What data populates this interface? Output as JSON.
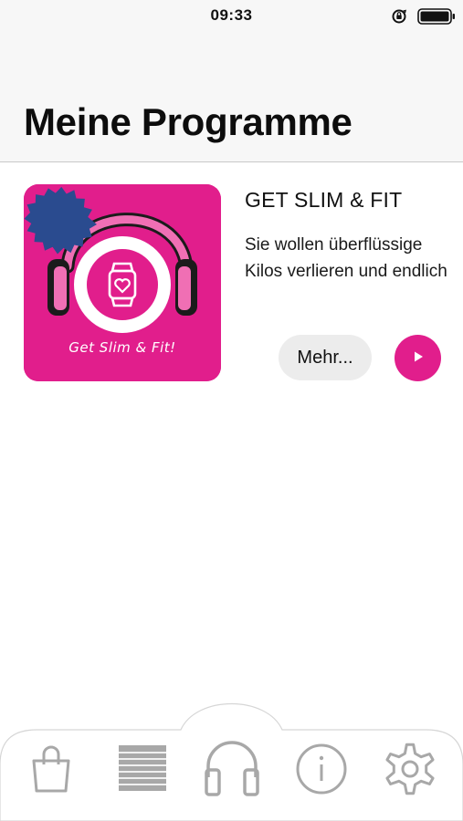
{
  "status_bar": {
    "time": "09:33",
    "icons": [
      "orientation-lock-icon",
      "battery-icon"
    ]
  },
  "header": {
    "title": "Meine Programme"
  },
  "programs": [
    {
      "title": "GET SLIM & FIT",
      "description": "Sie wollen überflüssige Kilos verlieren und endlich",
      "cover_caption": "Get Slim & Fit!",
      "more_label": "Mehr...",
      "play_icon": "play-icon"
    }
  ],
  "tab_bar": {
    "tabs": [
      {
        "id": "shop",
        "icon": "shopping-bag-icon"
      },
      {
        "id": "list",
        "icon": "list-icon"
      },
      {
        "id": "programs",
        "icon": "headphones-icon",
        "selected": true
      },
      {
        "id": "info",
        "icon": "info-icon"
      },
      {
        "id": "settings",
        "icon": "gear-icon"
      }
    ]
  },
  "colors": {
    "accent": "#e11e8c",
    "cover_badge": "#2a4b8f",
    "tab_icon": "#a8a8a8",
    "header_bg": "#f7f7f7"
  }
}
